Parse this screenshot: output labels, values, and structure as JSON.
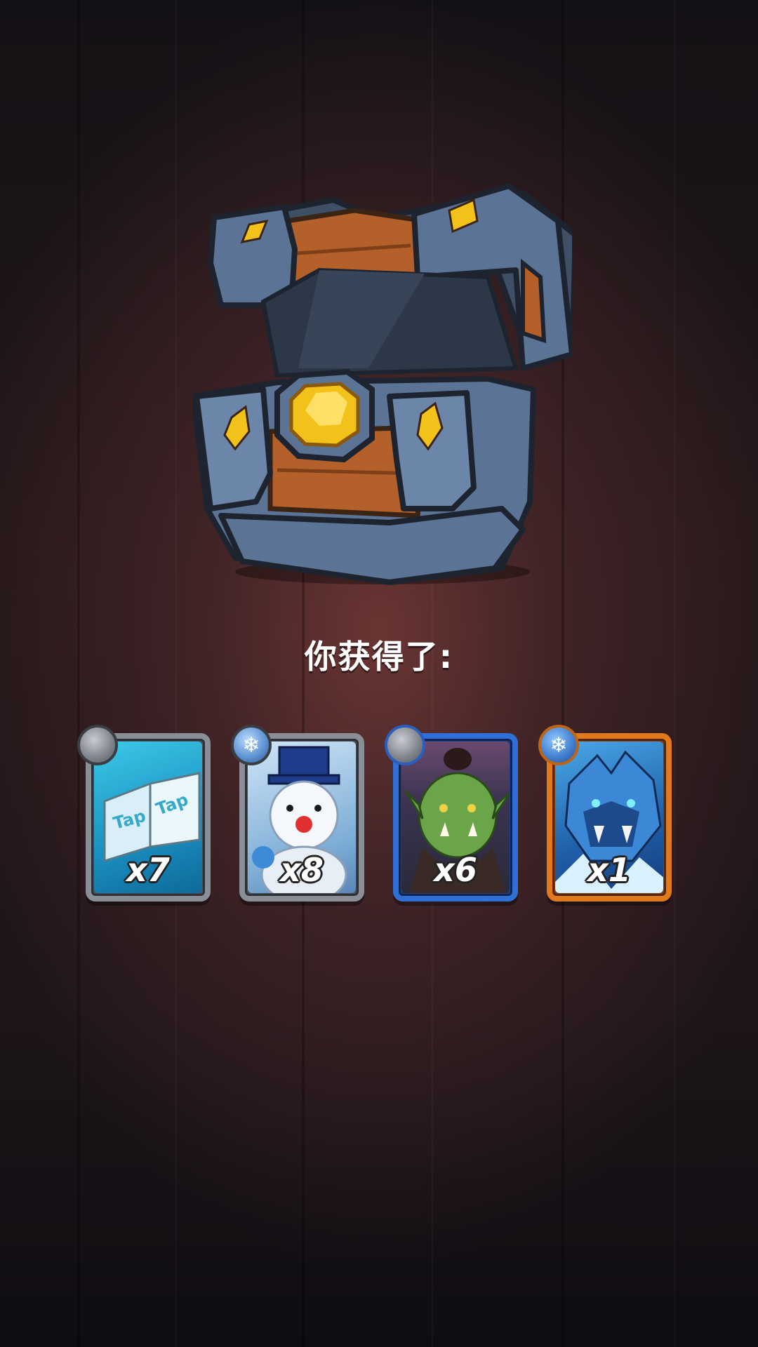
{
  "reward_screen": {
    "title": "你获得了:"
  },
  "cards": [
    {
      "name": "tap-tap-tome-card",
      "quantity": "x7",
      "rarity": "common",
      "gem": "grey",
      "icon": "book-icon"
    },
    {
      "name": "snowman-card",
      "quantity": "x8",
      "rarity": "common",
      "gem": "snowflake",
      "icon": "snowman-icon"
    },
    {
      "name": "orc-card",
      "quantity": "x6",
      "rarity": "rare",
      "gem": "grey",
      "icon": "orc-icon"
    },
    {
      "name": "ice-dragon-card",
      "quantity": "x1",
      "rarity": "epic",
      "gem": "snowflake",
      "icon": "dragon-icon"
    }
  ],
  "colors": {
    "common_border": "#8a8f97",
    "rare_border": "#2f6fd6",
    "epic_border": "#e07a1c",
    "chest_metal": "#5b7496",
    "chest_wood": "#b4602a",
    "gold_gem": "#f2c21a"
  }
}
